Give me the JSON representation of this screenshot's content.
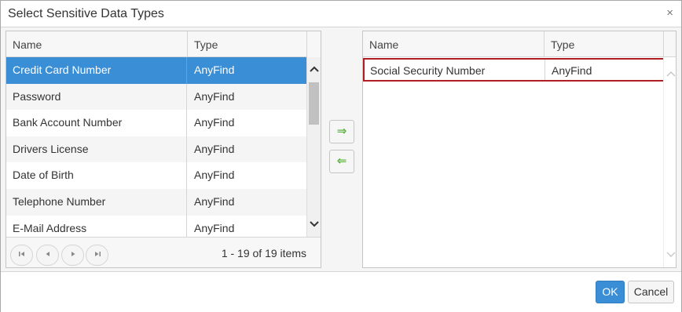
{
  "dialog": {
    "title": "Select Sensitive Data Types",
    "close_glyph": "×"
  },
  "available": {
    "columns": {
      "name": "Name",
      "type": "Type"
    },
    "rows": [
      {
        "name": "Credit Card Number",
        "type": "AnyFind",
        "selected": true
      },
      {
        "name": "Password",
        "type": "AnyFind"
      },
      {
        "name": "Bank Account Number",
        "type": "AnyFind"
      },
      {
        "name": "Drivers License",
        "type": "AnyFind"
      },
      {
        "name": "Date of Birth",
        "type": "AnyFind"
      },
      {
        "name": "Telephone Number",
        "type": "AnyFind"
      },
      {
        "name": "E-Mail Address",
        "type": "AnyFind"
      }
    ],
    "pager": {
      "info": "1 - 19 of 19 items",
      "first_icon": "first-page-icon",
      "prev_icon": "prev-page-icon",
      "next_icon": "next-page-icon",
      "last_icon": "last-page-icon"
    }
  },
  "selected": {
    "columns": {
      "name": "Name",
      "type": "Type"
    },
    "rows": [
      {
        "name": "Social Security Number",
        "type": "AnyFind"
      }
    ]
  },
  "move": {
    "add_icon": "arrow-right-icon",
    "remove_icon": "arrow-left-icon"
  },
  "footer": {
    "ok_label": "OK",
    "cancel_label": "Cancel"
  },
  "colors": {
    "accent": "#3a8ed6",
    "highlight_border": "#b01e23",
    "arrow_green": "#5bb33f"
  }
}
